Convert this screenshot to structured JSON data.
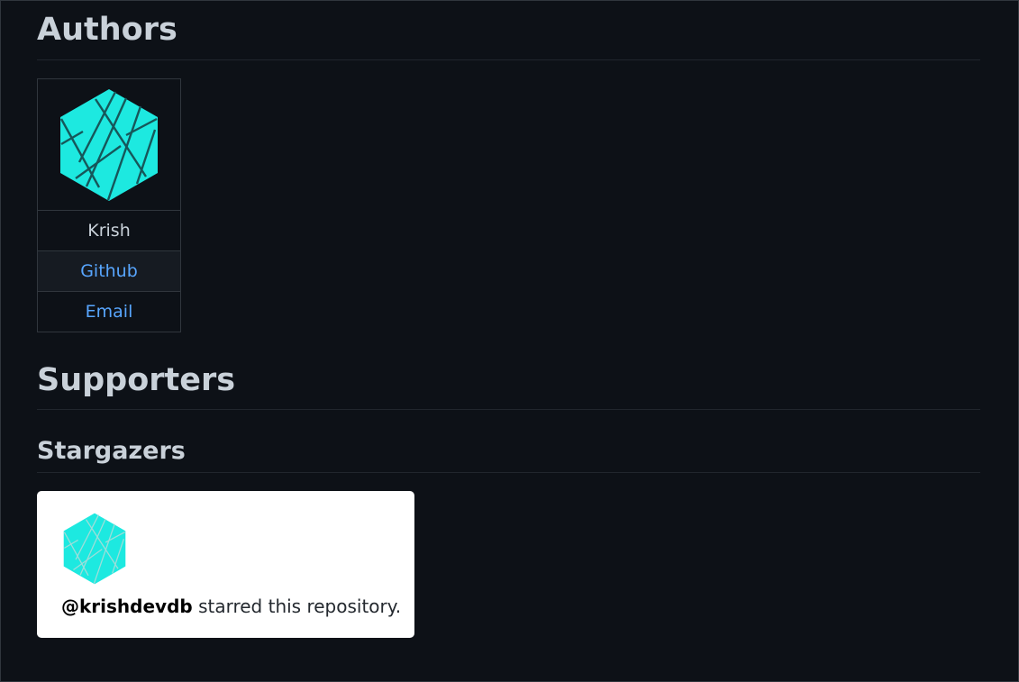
{
  "authors": {
    "heading": "Authors",
    "author_name": "Krish",
    "github_label": "Github",
    "email_label": "Email"
  },
  "supporters": {
    "heading": "Supporters",
    "stargazers_heading": "Stargazers",
    "stargazer_handle": "@krishdevdb",
    "stargazer_action": " starred this repository."
  },
  "colors": {
    "background": "#0d1117",
    "heading_text": "#c9d1d9",
    "link": "#58a6ff",
    "avatar_fill": "#1de9e0",
    "card_background": "#ffffff"
  },
  "icons": {
    "author_avatar": "hexagon-logo-icon",
    "stargazer_avatar": "hexagon-logo-icon"
  }
}
